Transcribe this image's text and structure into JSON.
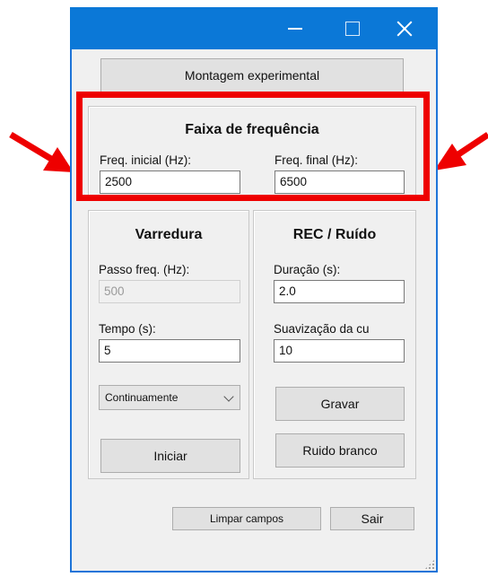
{
  "window": {
    "title": "",
    "controls": [
      "minimize-icon",
      "maximize-icon",
      "close-icon"
    ]
  },
  "buttons": {
    "montagem": "Montagem experimental",
    "iniciar": "Iniciar",
    "gravar": "Gravar",
    "ruido_branco": "Ruido branco",
    "limpar": "Limpar campos",
    "sair": "Sair"
  },
  "faixa": {
    "title": "Faixa de frequência",
    "freq_inicial_label": "Freq. inicial (Hz):",
    "freq_inicial_value": "2500",
    "freq_final_label": "Freq. final (Hz):",
    "freq_final_value": "6500"
  },
  "varredura": {
    "title": "Varredura",
    "passo_label": "Passo freq. (Hz):",
    "passo_value": "500",
    "tempo_label": "Tempo (s):",
    "tempo_value": "5",
    "mode_selected": "Continuamente"
  },
  "rec": {
    "title": "REC / Ruído",
    "duracao_label": "Duração (s):",
    "duracao_value": "2.0",
    "suavizacao_label": "Suavização da cu",
    "suavizacao_value": "10"
  },
  "annotations": {
    "highlight_color": "#ee0000",
    "arrow_color": "#ee0000"
  }
}
